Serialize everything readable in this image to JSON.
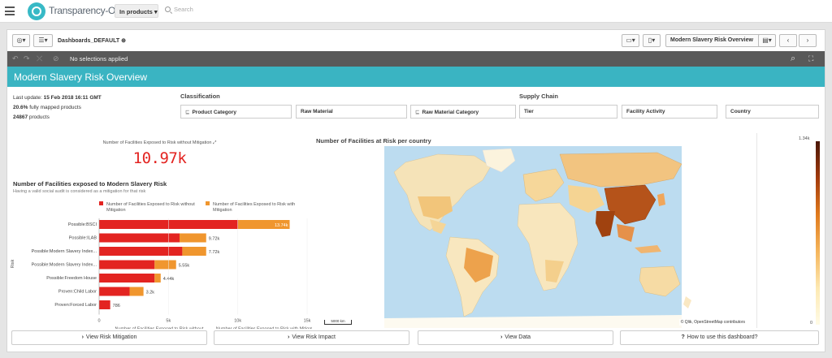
{
  "topbar": {
    "brand": "Transparency-One",
    "scope_label": "In products",
    "search_placeholder": "Search"
  },
  "toolbar": {
    "dashboard_label": "Dashboards_DEFAULT",
    "sheet_name": "Modern Slavery Risk Overview"
  },
  "selection_bar": {
    "text": "No selections applied"
  },
  "page_title": "Modern Slavery Risk Overview",
  "info": {
    "last_update_label": "Last update:",
    "last_update_value": "15 Feb 2018 16:11 GMT",
    "mapped_pct": "20.6%",
    "mapped_text": "fully mapped products",
    "products_count": "24867",
    "products_text": "products"
  },
  "sections": {
    "classification": "Classification",
    "supply_chain": "Supply Chain"
  },
  "filters": [
    {
      "label": "Product Category",
      "hierarchy": true
    },
    {
      "label": "Raw Material",
      "hierarchy": false
    },
    {
      "label": "Raw Material Category",
      "hierarchy": true
    },
    {
      "label": "Tier",
      "hierarchy": false
    },
    {
      "label": "Facility Activity",
      "hierarchy": false
    },
    {
      "label": "Country",
      "hierarchy": false
    }
  ],
  "kpi": {
    "title": "Number of Facilities Exposed to Risk without Mitigation",
    "value": "10.97k"
  },
  "chart": {
    "title": "Number of Facilities exposed to Modern Slavery Risk",
    "subtitle": "Having a valid social audit is considered as a mitigation for that risk"
  },
  "chart_data": {
    "type": "bar",
    "orientation": "horizontal",
    "stacked": true,
    "categories": [
      "Possible:BSCI",
      "Possible:ILAB",
      "Possible:Modern Slavery Index...",
      "Possible:Modern Slavery Index...",
      "Possible:Freedom House",
      "Proven:Child Labor",
      "Proven:Forced Labor"
    ],
    "series": [
      {
        "name": "Number of Facilities Exposed to Risk without Mitigation",
        "color": "#e32421",
        "values": [
          10000,
          5800,
          6000,
          4000,
          4000,
          2200,
          800
        ]
      },
      {
        "name": "Number of Facilities Exposed to Risk with Mitigation",
        "color": "#f0962e",
        "values": [
          3740,
          1920,
          1720,
          1550,
          440,
          1000,
          -14
        ]
      }
    ],
    "data_labels": [
      "13.74k",
      "9.72k",
      "7.72k",
      "5.55k",
      "4.44k",
      "3.2k",
      "786"
    ],
    "ylabel": "Risk",
    "xlabels": [
      "Number of Facilities Exposed to Risk without ...",
      "Number of Facilities Exposed to Risk with Mitigation"
    ],
    "xticks": [
      "0",
      "5k",
      "10k",
      "15k"
    ],
    "xlim": [
      0,
      15000
    ],
    "legend_position": "top"
  },
  "map": {
    "title": "Number of Facilities at Risk per country",
    "attribution": "© Qlik, OpenStreetMap contributors",
    "scale": "5000 km",
    "legend_max": "1.34k",
    "legend_min": "0"
  },
  "buttons": {
    "risk_mitigation": "View Risk Mitigation",
    "risk_impact": "View Risk Impact",
    "view_data": "View Data",
    "how_to": "How to use this dashboard?"
  },
  "colors": {
    "accent": "#3ab4c2",
    "without_mitigation": "#e32421",
    "with_mitigation": "#f0962e"
  }
}
